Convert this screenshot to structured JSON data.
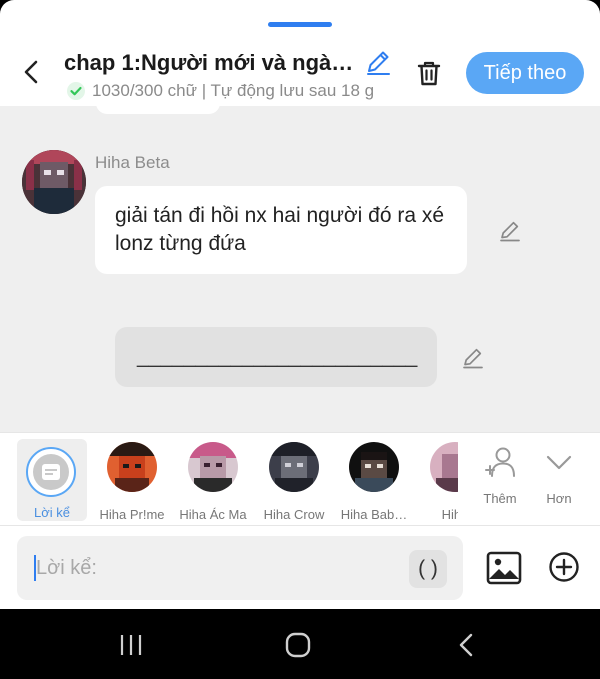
{
  "header": {
    "title": "chap 1:Người mới và ngày …",
    "word_count": "1030/300 chữ",
    "separator": " | ",
    "autosave": "Tự động lưu sau 18 g",
    "next_label": "Tiếp theo"
  },
  "chat": {
    "sender": "Hiha Beta",
    "message": "giải tán đi hồi nx hai người đó ra xé lonz từng đứa",
    "draft": "________________________"
  },
  "characters": {
    "narrator_label": "Lời kể",
    "items": [
      {
        "label": "Hiha Pr!me"
      },
      {
        "label": "Hiha Ác Ma"
      },
      {
        "label": "Hiha Crow"
      },
      {
        "label": "Hiha Bab…"
      },
      {
        "label": "Hiha"
      }
    ],
    "add_label": "Thêm",
    "more_label": "Hơn"
  },
  "composer": {
    "placeholder": "Lời kể:",
    "paren_label": "( )"
  },
  "colors": {
    "accent": "#5aa7f5",
    "accent_dark": "#2f7ef0",
    "success": "#34c759",
    "chat_bg": "#efefef"
  },
  "icons": {
    "back": "chevron-left-icon",
    "edit": "pencil-icon",
    "trash": "trash-icon",
    "check": "check-circle-icon",
    "add_character": "user-plus-icon",
    "more": "chevron-down-icon",
    "image": "image-icon",
    "plus": "plus-circle-icon"
  }
}
